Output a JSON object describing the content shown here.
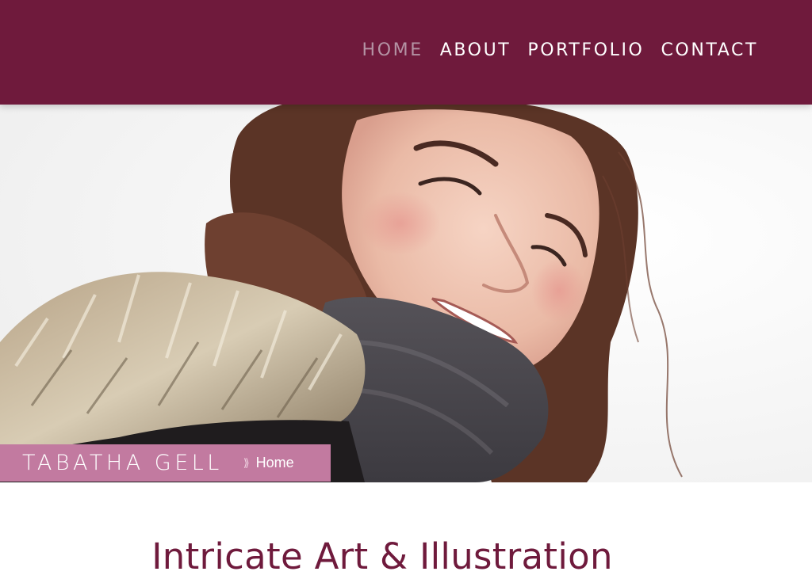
{
  "header": {
    "nav": [
      {
        "label": "HOME",
        "active": true
      },
      {
        "label": "ABOUT",
        "active": false
      },
      {
        "label": "PORTFOLIO",
        "active": false
      },
      {
        "label": "CONTACT",
        "active": false
      }
    ]
  },
  "hero": {
    "image": "portrait-photo"
  },
  "breadcrumb": {
    "site_name": "TABATHA GELL",
    "separator": "⟫",
    "current": "Home"
  },
  "main": {
    "title": "Intricate Art & Illustration"
  },
  "colors": {
    "header_bg": "#6f1a3c",
    "nav_active": "#b493a4",
    "breadcrumb_bg": "#c27aa0",
    "title": "#6f1a3c"
  }
}
